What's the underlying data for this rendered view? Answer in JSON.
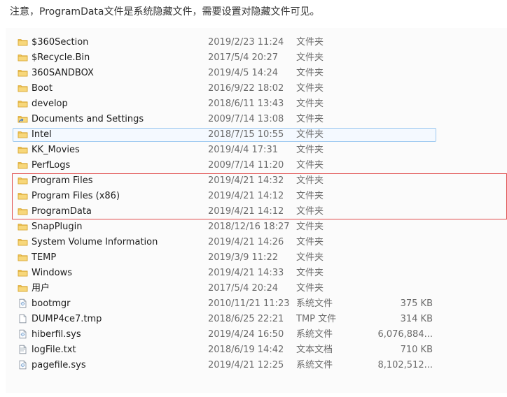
{
  "note": "注意，ProgramData文件是系统隐藏文件，需要设置对隐藏文件可见。",
  "colors": {
    "folder": "#f4c95d",
    "folder_dark": "#d8a52f",
    "file": "#ffffff",
    "file_border": "#7f8a98",
    "selection_border": "#9fcaf0",
    "highlight_box": "#e04a4a"
  },
  "files": [
    {
      "name": "$360Section",
      "date": "2019/2/23 11:24",
      "type": "文件夹",
      "size": "",
      "icon": "folder-icon"
    },
    {
      "name": "$Recycle.Bin",
      "date": "2017/5/4 20:27",
      "type": "文件夹",
      "size": "",
      "icon": "folder-icon"
    },
    {
      "name": "360SANDBOX",
      "date": "2019/4/5 14:24",
      "type": "文件夹",
      "size": "",
      "icon": "folder-icon"
    },
    {
      "name": "Boot",
      "date": "2016/9/22 18:02",
      "type": "文件夹",
      "size": "",
      "icon": "folder-icon"
    },
    {
      "name": "develop",
      "date": "2018/6/11 13:43",
      "type": "文件夹",
      "size": "",
      "icon": "folder-icon"
    },
    {
      "name": "Documents and Settings",
      "date": "2009/7/14 13:08",
      "type": "文件夹",
      "size": "",
      "icon": "folder-shortcut-icon"
    },
    {
      "name": "Intel",
      "date": "2018/7/15 10:55",
      "type": "文件夹",
      "size": "",
      "icon": "folder-icon"
    },
    {
      "name": "KK_Movies",
      "date": "2019/4/4 17:31",
      "type": "文件夹",
      "size": "",
      "icon": "folder-icon"
    },
    {
      "name": "PerfLogs",
      "date": "2009/7/14 11:20",
      "type": "文件夹",
      "size": "",
      "icon": "folder-icon"
    },
    {
      "name": "Program Files",
      "date": "2019/4/21 14:32",
      "type": "文件夹",
      "size": "",
      "icon": "folder-icon"
    },
    {
      "name": "Program Files (x86)",
      "date": "2019/4/21 14:12",
      "type": "文件夹",
      "size": "",
      "icon": "folder-icon"
    },
    {
      "name": "ProgramData",
      "date": "2019/4/21 14:12",
      "type": "文件夹",
      "size": "",
      "icon": "folder-icon"
    },
    {
      "name": "SnapPlugin",
      "date": "2018/12/16 18:27",
      "type": "文件夹",
      "size": "",
      "icon": "folder-icon"
    },
    {
      "name": "System Volume Information",
      "date": "2019/4/21 14:26",
      "type": "文件夹",
      "size": "",
      "icon": "folder-icon"
    },
    {
      "name": "TEMP",
      "date": "2019/3/9 11:22",
      "type": "文件夹",
      "size": "",
      "icon": "folder-icon"
    },
    {
      "name": "Windows",
      "date": "2019/4/21 14:33",
      "type": "文件夹",
      "size": "",
      "icon": "folder-icon"
    },
    {
      "name": "用户",
      "date": "2017/5/4 20:24",
      "type": "文件夹",
      "size": "",
      "icon": "folder-icon"
    },
    {
      "name": "bootmgr",
      "date": "2010/11/21 11:23",
      "type": "系统文件",
      "size": "375 KB",
      "icon": "system-file-icon"
    },
    {
      "name": "DUMP4ce7.tmp",
      "date": "2018/6/25 22:21",
      "type": "TMP 文件",
      "size": "314 KB",
      "icon": "file-icon"
    },
    {
      "name": "hiberfil.sys",
      "date": "2019/4/24 16:50",
      "type": "系统文件",
      "size": "6,076,884...",
      "icon": "system-file-icon"
    },
    {
      "name": "logFile.txt",
      "date": "2018/6/19 14:42",
      "type": "文本文档",
      "size": "710 KB",
      "icon": "text-file-icon"
    },
    {
      "name": "pagefile.sys",
      "date": "2019/4/21 12:25",
      "type": "系统文件",
      "size": "8,102,512...",
      "icon": "system-file-icon"
    }
  ]
}
